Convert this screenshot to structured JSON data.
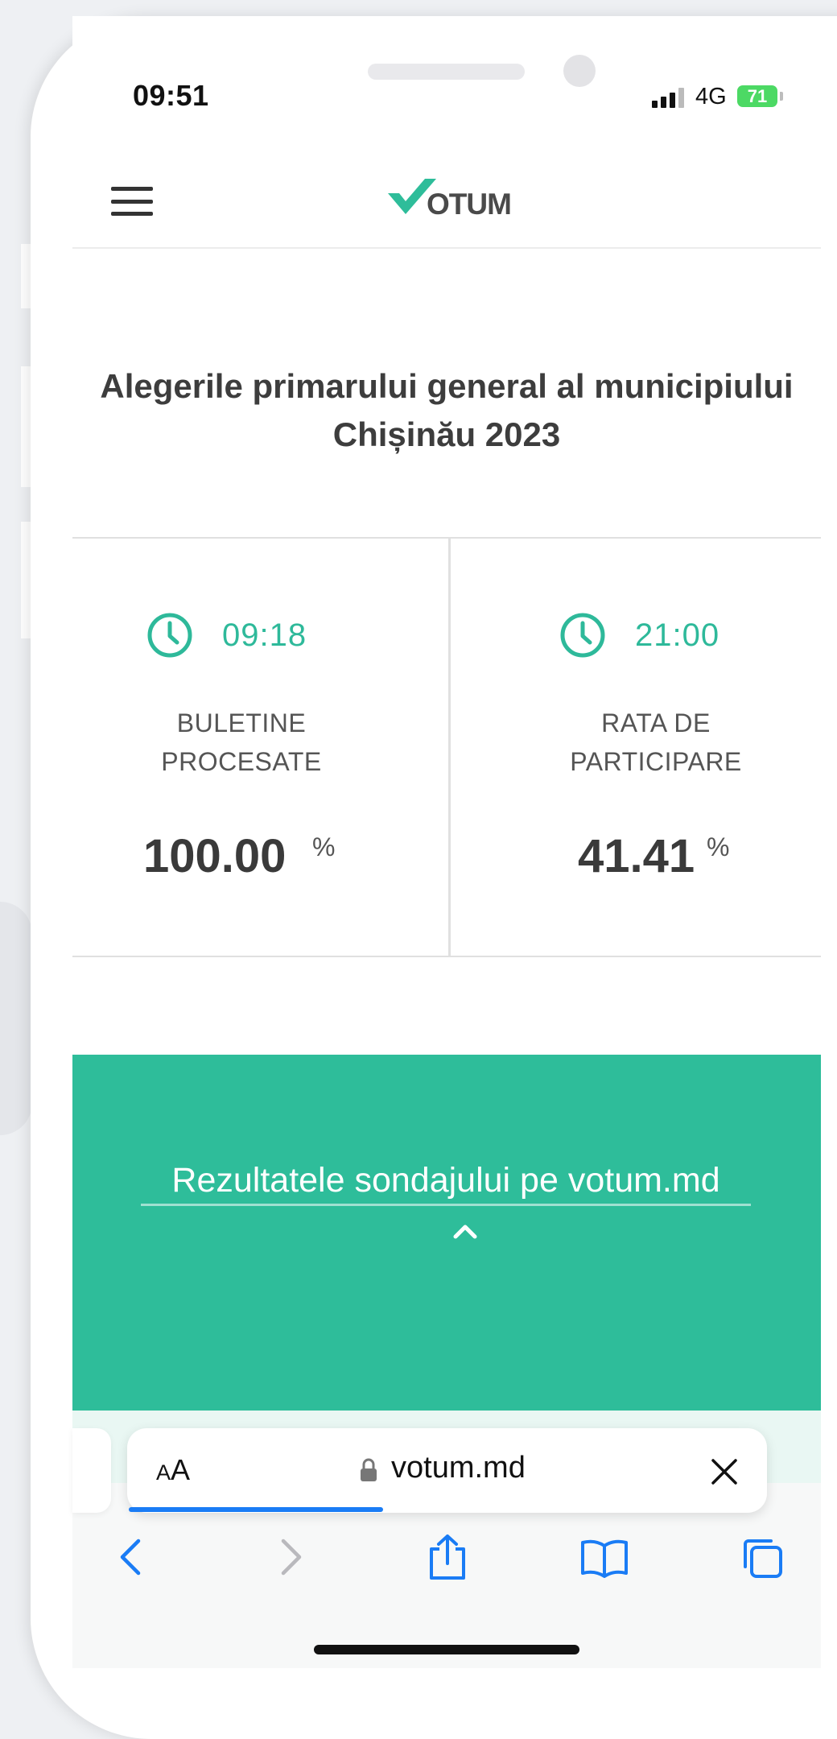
{
  "status_bar": {
    "time": "09:51",
    "network": "4G",
    "battery": "71"
  },
  "header": {
    "logo_text": "OTUM",
    "accent_color": "#2ebd9a"
  },
  "page": {
    "title": "Alegerile primarului general al municipiului Chișinău 2023"
  },
  "stats": [
    {
      "time": "09:18",
      "label": "BULETINE PROCESATE",
      "value": "100.00",
      "unit": "%"
    },
    {
      "time": "21:00",
      "label": "RATA DE PARTICIPARE",
      "value": "41.41",
      "unit": "%"
    }
  ],
  "banner": {
    "link_text": "Rezultatele sondajului pe votum.md",
    "background_color": "#2ebd9a"
  },
  "browser": {
    "text_size_button": "AA",
    "url": "votum.md",
    "load_progress": 0.34,
    "toolbar_icons": [
      "back-icon",
      "forward-icon",
      "share-icon",
      "bookmarks-icon",
      "tabs-icon"
    ],
    "link_color": "#1a7cf5"
  }
}
